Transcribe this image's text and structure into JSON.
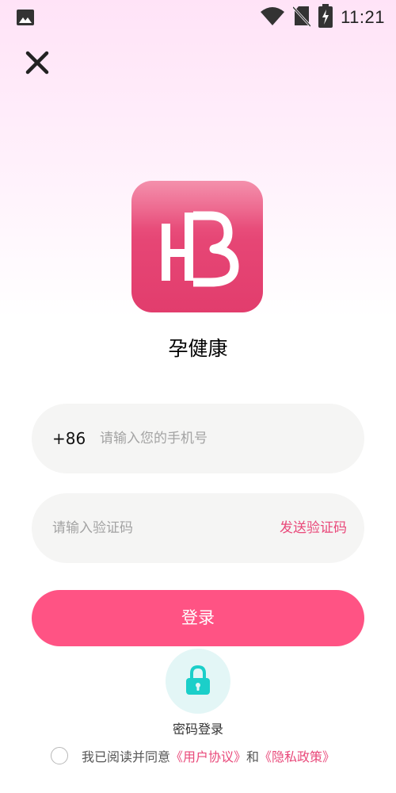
{
  "status_bar": {
    "time": "11:21",
    "left_icon": "image-icon",
    "right_icons": [
      "wifi-icon",
      "no-sim-icon",
      "battery-charging-icon"
    ]
  },
  "header": {
    "close_icon": "close-icon"
  },
  "app": {
    "name": "孕健康",
    "logo_icon": "hb-logo-icon"
  },
  "phone_field": {
    "country_code": "+86",
    "placeholder": "请输入您的手机号",
    "value": ""
  },
  "code_field": {
    "placeholder": "请输入验证码",
    "value": "",
    "send_code_label": "发送验证码"
  },
  "login_button": {
    "label": "登录"
  },
  "password_login": {
    "icon": "lock-icon",
    "label": "密码登录"
  },
  "agreement": {
    "prefix": "我已阅读并同意",
    "user_agreement": "《用户协议》",
    "conjunction": "和",
    "privacy_policy": "《隐私政策》",
    "checked": false
  },
  "colors": {
    "accent": "#ff5384",
    "link": "#e9497a",
    "logo": "#e64675",
    "lock": "#1bcfc9"
  }
}
